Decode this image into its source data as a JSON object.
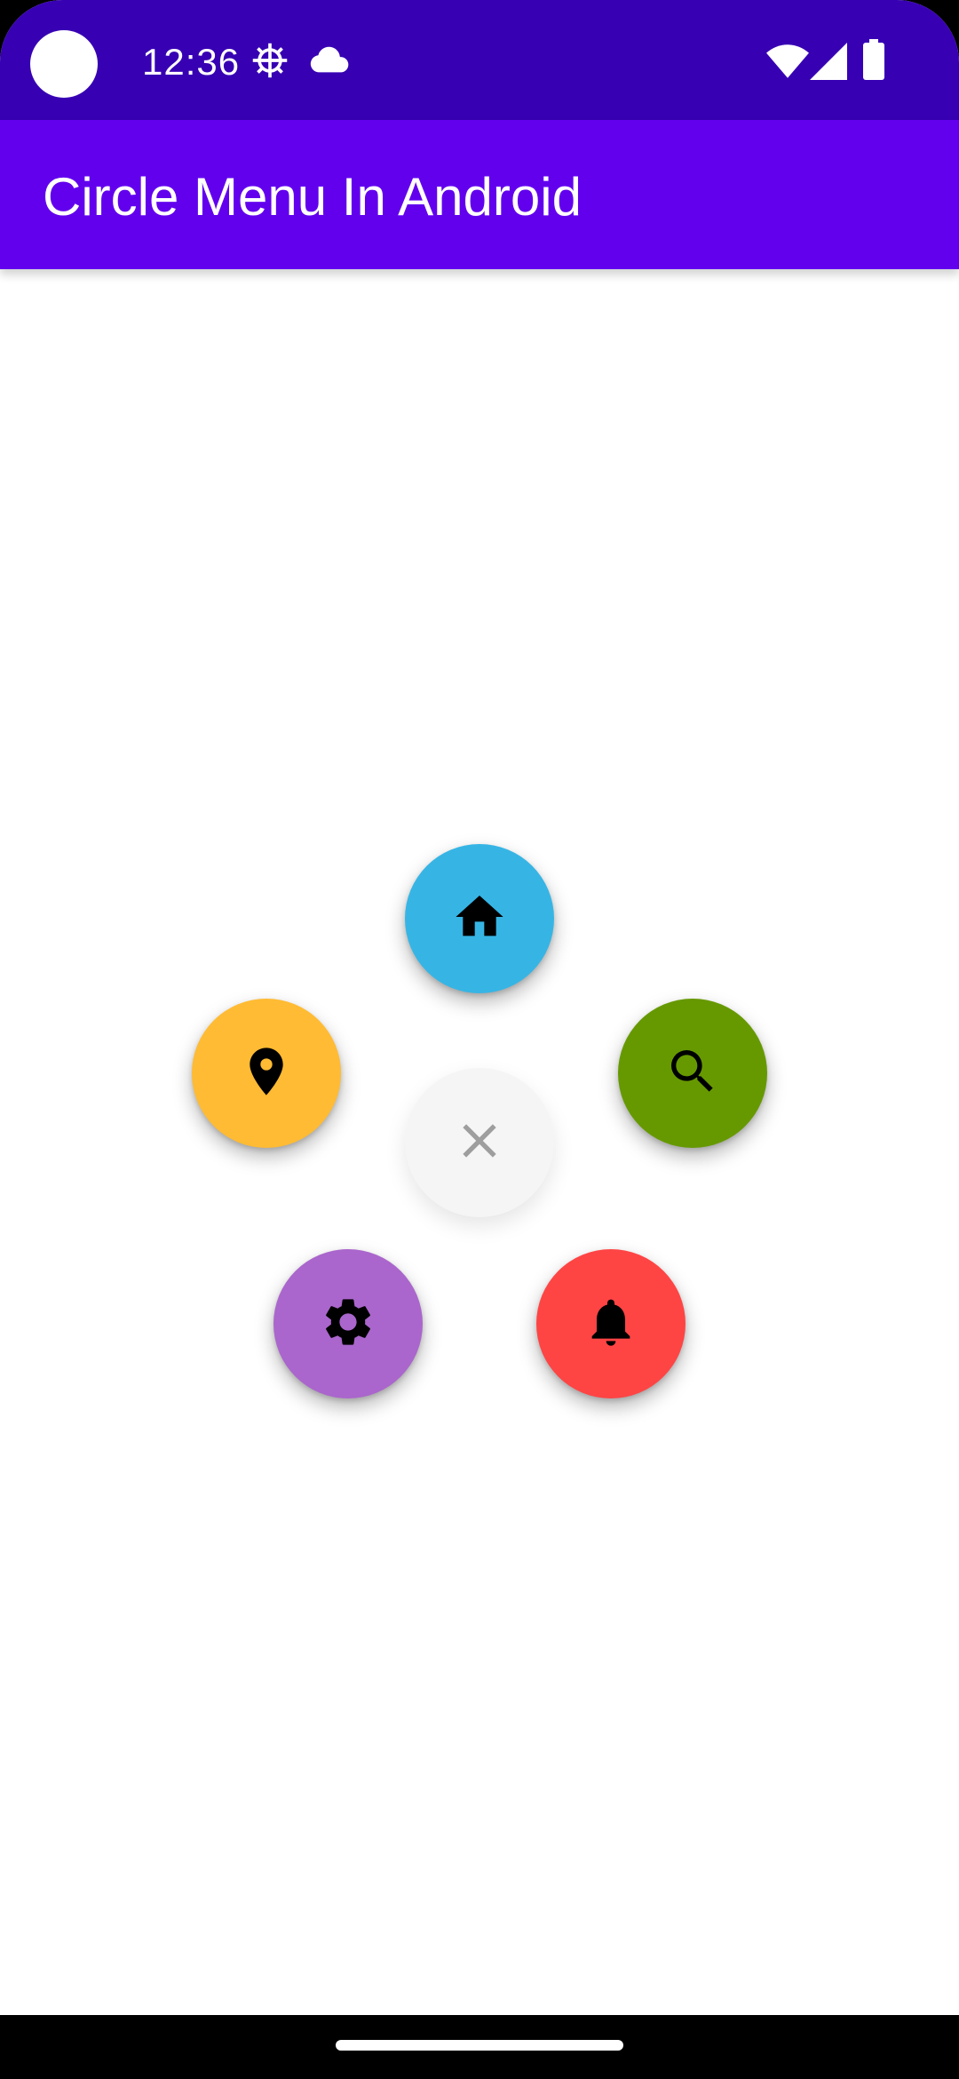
{
  "status_bar": {
    "time": "12:36",
    "icons": [
      "settings-gear-icon",
      "cloud-icon",
      "wifi-icon",
      "signal-icon",
      "battery-icon"
    ]
  },
  "app_bar": {
    "title": "Circle Menu In Android"
  },
  "circle_menu": {
    "state": "expanded",
    "center_button": {
      "icon": "close-icon",
      "color": "#f5f5f5",
      "icon_color": "#9e9e9e"
    },
    "items": [
      {
        "id": "home",
        "icon": "home-icon",
        "color": "#36b5e5"
      },
      {
        "id": "search",
        "icon": "search-icon",
        "color": "#669900"
      },
      {
        "id": "notifications",
        "icon": "bell-icon",
        "color": "#ff4444"
      },
      {
        "id": "settings",
        "icon": "settings-icon",
        "color": "#aa66cc"
      },
      {
        "id": "location",
        "icon": "location-pin-icon",
        "color": "#ffbb33"
      }
    ]
  },
  "colors": {
    "status_bar": "#3700b3",
    "app_bar": "#6200ee",
    "background": "#ffffff"
  }
}
